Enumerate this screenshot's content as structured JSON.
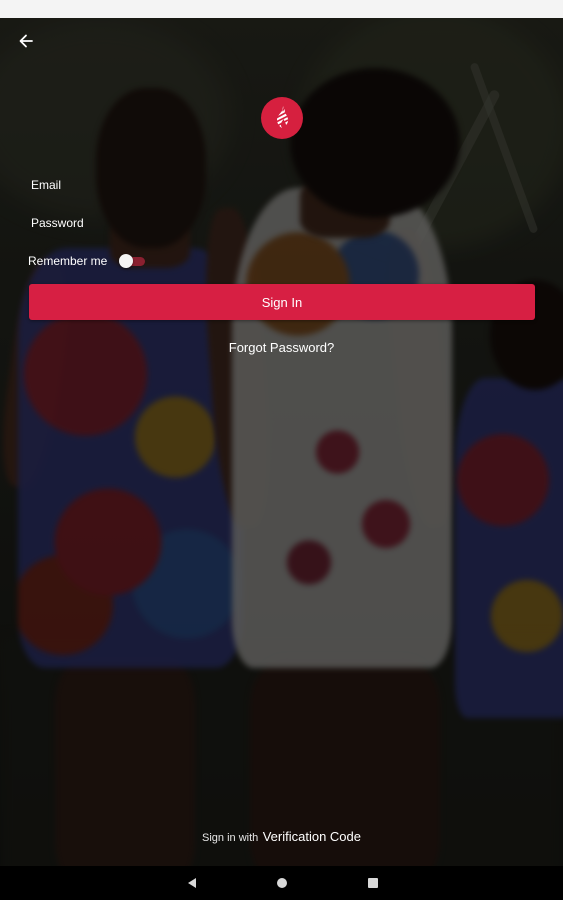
{
  "form": {
    "email_label": "Email",
    "email_value": "",
    "password_label": "Password",
    "password_value": "",
    "remember_label": "Remember me",
    "remember_on": false
  },
  "actions": {
    "sign_in_label": "Sign In",
    "forgot_password_label": "Forgot Password?"
  },
  "footer": {
    "verify_prefix": "Sign in with",
    "verify_link": "Verification Code"
  },
  "icons": {
    "back": "arrow-left-icon",
    "logo": "flame-logo-icon",
    "nav_back": "triangle-back-icon",
    "nav_home": "circle-home-icon",
    "nav_recents": "square-recents-icon"
  },
  "colors": {
    "accent": "#d71f43",
    "toggle_track": "#8a2030"
  }
}
